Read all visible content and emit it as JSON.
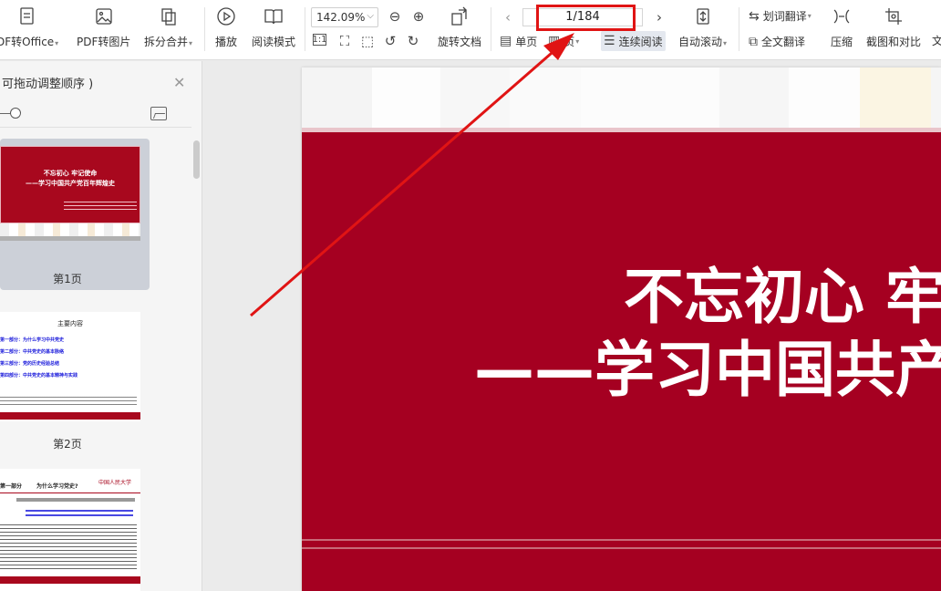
{
  "toolbar": {
    "pdf_to_office": "DF转Office",
    "pdf_to_image": "PDF转图片",
    "split_merge": "拆分合并",
    "play": "播放",
    "read_mode": "阅读模式",
    "zoom": "142.09%",
    "rotate_doc": "旋转文档",
    "page_indicator": "1/184",
    "single_page": "单页",
    "double_page": "页",
    "continuous_read": "连续阅读",
    "auto_scroll": "自动滚动",
    "word_translate": "划词翻译",
    "full_translate": "全文翻译",
    "compress": "压缩",
    "screenshot_compare": "截图和对比",
    "more_text": "文"
  },
  "sidebar": {
    "title": "可拖动调整顺序 )",
    "thumbnails": [
      {
        "label": "第1页",
        "title1": "不忘初心 牢记使命",
        "title2": "——学习中国共产党百年辉煌史"
      },
      {
        "label": "第2页",
        "heading": "主要内容",
        "items": [
          "第一部分：为什么学习中共党史",
          "第二部分：中共党史的基本脉络",
          "第三部分：党的历史经验总结",
          "第四部分：中共党史的基本精神与实践"
        ]
      },
      {
        "heading_left": "第一部分",
        "heading_right": "为什么学习党史?",
        "logo": "中国人民大学"
      }
    ]
  },
  "slide": {
    "line1": "不忘初心 牢",
    "line2": "——学习中国共产"
  },
  "colors": {
    "slide_red": "#a50021",
    "highlight_red": "#e01414"
  }
}
